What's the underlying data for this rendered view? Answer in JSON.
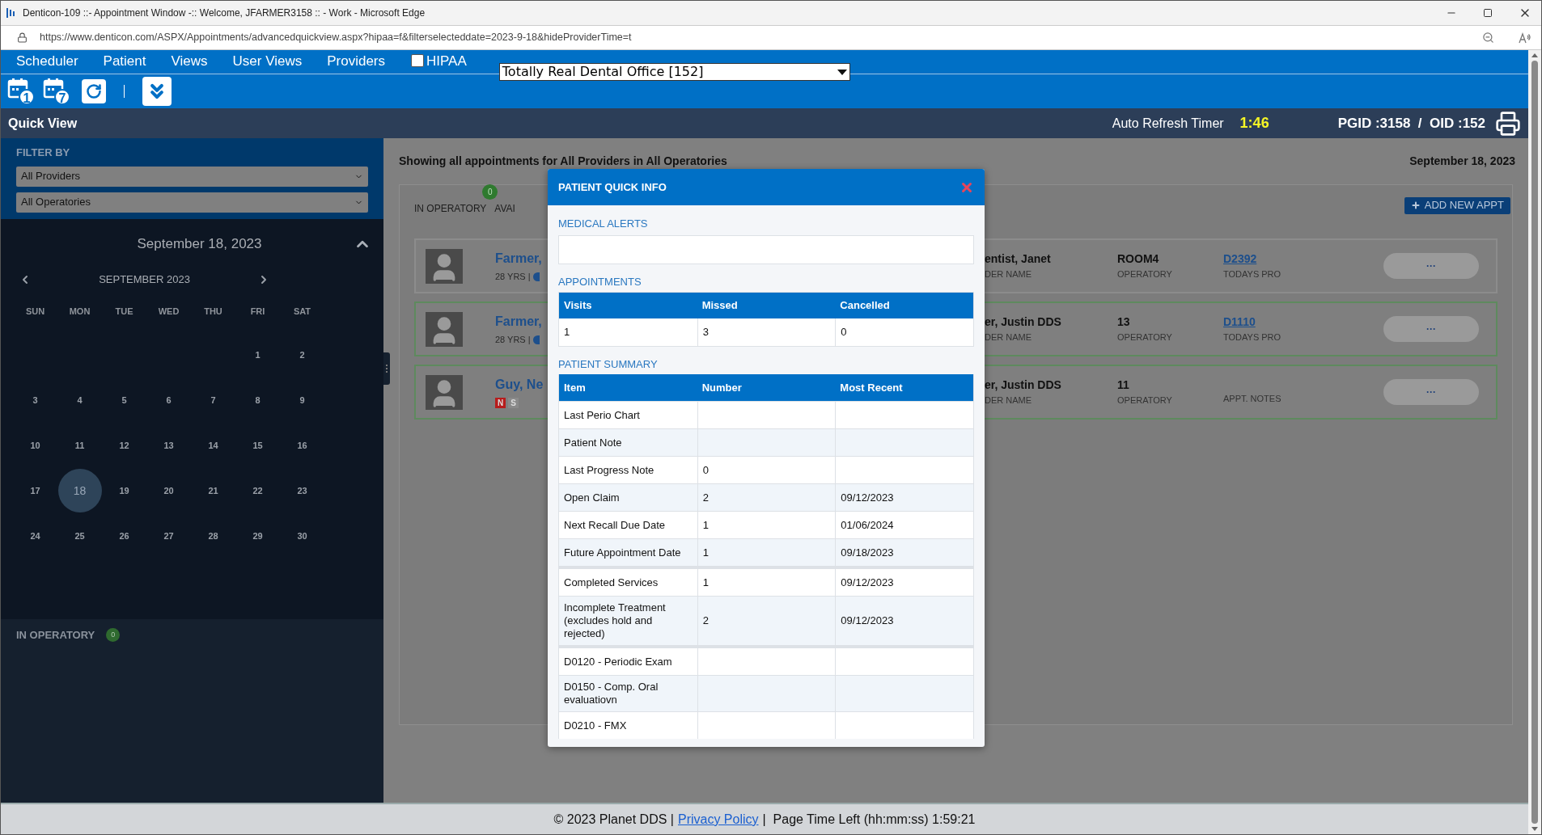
{
  "window": {
    "title": "Denticon-109 ::- Appointment Window -:: Welcome, JFARMER3158 :: - Work - Microsoft Edge"
  },
  "address_bar": {
    "url": "https://www.denticon.com/ASPX/Appointments/advancedquickview.aspx?hipaa=f&filterselecteddate=2023-9-18&hideProviderTime=t"
  },
  "menu": [
    "Scheduler",
    "Patient",
    "Views",
    "User Views",
    "Providers"
  ],
  "hipaa": {
    "label": "HIPAA",
    "checked": false
  },
  "office_select": {
    "value": "Totally Real Dental Office [152]"
  },
  "toolbar": {
    "day_view": "1",
    "week_view": "7"
  },
  "header": {
    "title": "Quick View",
    "timer_label": "Auto Refresh Timer",
    "timer": "1:46",
    "ids": "PGID :3158  /  OID :152"
  },
  "filter": {
    "heading": "FILTER BY",
    "providers": "All Providers",
    "operatories": "All Operatories"
  },
  "calendar": {
    "date": "September 18, 2023",
    "month": "SEPTEMBER 2023",
    "weekdays": [
      "SUN",
      "MON",
      "TUE",
      "WED",
      "THU",
      "FRI",
      "SAT"
    ],
    "weeks": [
      {
        "days": [
          {
            "kind": "empty"
          },
          {
            "kind": "empty"
          },
          {
            "kind": "empty"
          },
          {
            "kind": "empty"
          },
          {
            "kind": "empty"
          },
          {
            "kind": "day",
            "day": "1",
            "selected": false
          },
          {
            "kind": "day",
            "day": "2",
            "selected": false
          }
        ]
      },
      {
        "days": [
          {
            "day": "3",
            "selected": false
          },
          {
            "day": "4",
            "selected": false
          },
          {
            "day": "5",
            "selected": false
          },
          {
            "day": "6",
            "selected": false
          },
          {
            "day": "7",
            "selected": false
          },
          {
            "day": "8",
            "selected": false
          },
          {
            "day": "9",
            "selected": false
          }
        ]
      },
      {
        "days": [
          {
            "day": "10",
            "selected": false
          },
          {
            "day": "11",
            "selected": false
          },
          {
            "day": "12",
            "selected": false
          },
          {
            "day": "13",
            "selected": false
          },
          {
            "day": "14",
            "selected": false
          },
          {
            "day": "15",
            "selected": false
          },
          {
            "day": "16",
            "selected": false
          }
        ]
      },
      {
        "days": [
          {
            "day": "17",
            "selected": false
          },
          {
            "day": "18",
            "selected": true
          },
          {
            "day": "19",
            "selected": false
          },
          {
            "day": "20",
            "selected": false
          },
          {
            "day": "21",
            "selected": false
          },
          {
            "day": "22",
            "selected": false
          },
          {
            "day": "23",
            "selected": false
          }
        ]
      },
      {
        "days": [
          {
            "day": "24",
            "selected": false
          },
          {
            "day": "25",
            "selected": false
          },
          {
            "day": "26",
            "selected": false
          },
          {
            "day": "27",
            "selected": false
          },
          {
            "day": "28",
            "selected": false
          },
          {
            "day": "29",
            "selected": false
          },
          {
            "day": "30",
            "selected": false
          }
        ]
      }
    ]
  },
  "in_operatory": {
    "label": "IN OPERATORY",
    "count": "0"
  },
  "main": {
    "summary": "Showing all appointments for All Providers in All Operatories",
    "date": "September 18, 2023",
    "tabs": [
      {
        "label": "IN OPERATORY",
        "badge": "0"
      },
      {
        "label": "AVAI"
      }
    ],
    "add_button": "ADD NEW APPT",
    "appointments": [
      {
        "name": "Farmer,",
        "age": "28 YRS |",
        "provider": "entist, Janet",
        "provider_label": "DER NAME",
        "operatory": "ROOM4",
        "operatory_label": "OPERATORY",
        "procedure": "D2392",
        "procedure_label": "TODAYS PRO",
        "action": "···",
        "color": "#8c8c8c"
      },
      {
        "name": "Farmer,",
        "age": "28 YRS |",
        "provider": "er, Justin DDS",
        "provider_label": "DER NAME",
        "operatory": "13",
        "operatory_label": "OPERATORY",
        "procedure": "D1110",
        "procedure_label": "TODAYS PRO",
        "action": "···",
        "color": "#5e8a5e"
      },
      {
        "name": "Guy, Ne",
        "flags": [
          {
            "label": "N",
            "color": "#b71c1c"
          },
          {
            "label": "S",
            "color": "#8a8a8a"
          }
        ],
        "provider": "er, Justin DDS",
        "provider_label": "DER NAME",
        "operatory": "11",
        "operatory_label": "OPERATORY",
        "procedure_label": "APPT. NOTES",
        "action": "···",
        "color": "#5e8a5e"
      }
    ]
  },
  "modal": {
    "title": "PATIENT QUICK INFO",
    "medical_alerts": "MEDICAL ALERTS",
    "appointments": {
      "heading": "APPOINTMENTS",
      "columns": [
        "Visits",
        "Missed",
        "Cancelled"
      ],
      "rows": [
        [
          "1",
          "3",
          "0"
        ]
      ]
    },
    "summary": {
      "heading": "PATIENT SUMMARY",
      "columns": [
        "Item",
        "Number",
        "Most Recent"
      ],
      "rows": [
        {
          "cells": [
            "Last Perio Chart",
            null,
            null
          ],
          "divider_above": false
        },
        {
          "cells": [
            "Patient Note",
            null,
            null
          ],
          "divider_above": false
        },
        {
          "cells": [
            "Last Progress Note",
            "0",
            null
          ],
          "divider_above": false
        },
        {
          "cells": [
            "Open Claim",
            "2",
            "09/12/2023"
          ],
          "divider_above": false
        },
        {
          "cells": [
            "Next Recall Due Date",
            "1",
            "01/06/2024"
          ],
          "divider_above": false
        },
        {
          "cells": [
            "Future Appointment Date",
            "1",
            "09/18/2023"
          ],
          "divider_above": false
        },
        {
          "cells": [
            "Completed Services",
            "1",
            "09/12/2023"
          ],
          "divider_above": true
        },
        {
          "cells": [
            "Incomplete Treatment (excludes hold and rejected)",
            "2",
            "09/12/2023"
          ],
          "divider_above": false
        },
        {
          "cells": [
            "D0120 - Periodic Exam",
            null,
            null
          ],
          "divider_above": true
        },
        {
          "cells": [
            "D0150 - Comp. Oral evaluatiovn",
            null,
            null
          ],
          "divider_above": false
        },
        {
          "cells": [
            "D0210 - FMX",
            null,
            null
          ],
          "divider_above": false
        }
      ]
    }
  },
  "footer": {
    "copyright": "© 2023 Planet DDS |",
    "link": "Privacy Policy",
    "time_left": "|  Page Time Left (hh:mm:ss) 1:59:21"
  }
}
